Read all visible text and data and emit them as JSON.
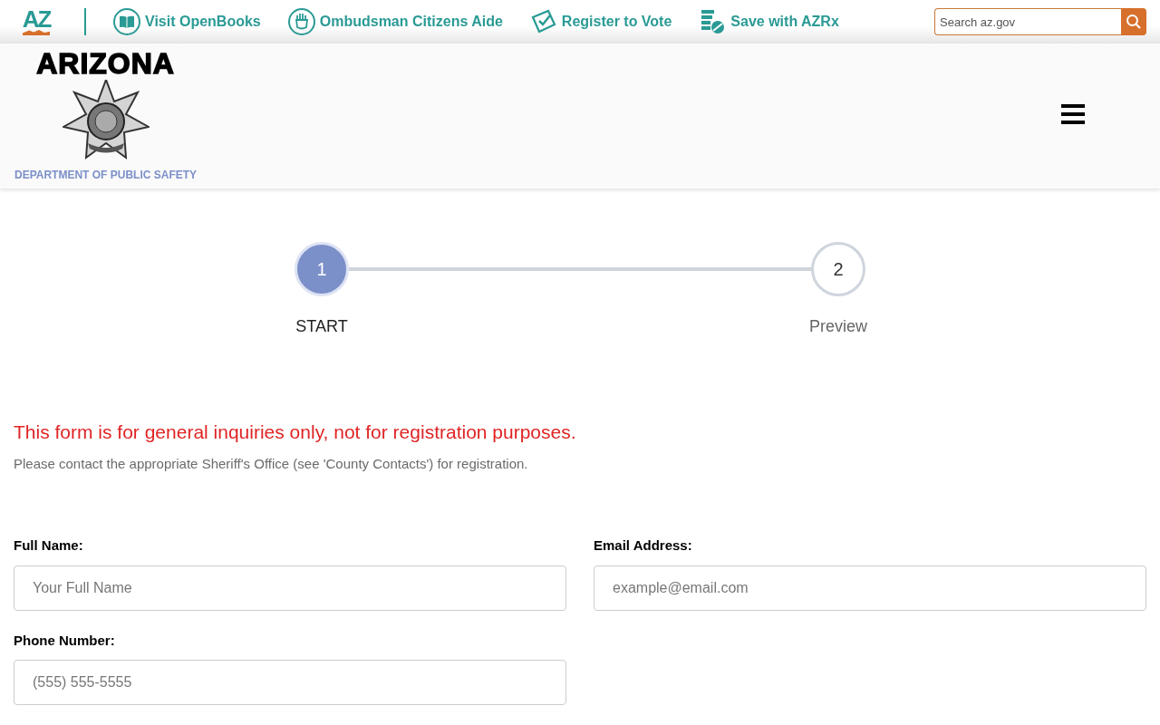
{
  "top_bar": {
    "logo_text": "AZ",
    "links": [
      {
        "kind": "book",
        "label": "Visit OpenBooks"
      },
      {
        "kind": "hand",
        "label": "Ombudsman Citizens Aide"
      },
      {
        "kind": "ballot",
        "label": "Register to Vote"
      },
      {
        "kind": "pills",
        "label": "Save with AZRx"
      }
    ],
    "search": {
      "placeholder": "Search az.gov"
    }
  },
  "header": {
    "wordmark": "ARIZONA",
    "department": "DEPARTMENT OF PUBLIC SAFETY"
  },
  "steps": [
    {
      "number": "1",
      "label": "START",
      "selected": true
    },
    {
      "number": "2",
      "label": "Preview",
      "selected": false
    }
  ],
  "notice": {
    "title": "This form is for general inquiries only, not for registration purposes.",
    "text": "Please contact the appropriate Sheriff's Office (see 'County Contacts') for registration."
  },
  "fields": [
    {
      "label": "Full Name:",
      "placeholder": "Your Full Name"
    },
    {
      "label": "Email Address:",
      "placeholder": "example@email.com"
    },
    {
      "label": "Phone Number:",
      "placeholder": "(555) 555-5555"
    }
  ]
}
